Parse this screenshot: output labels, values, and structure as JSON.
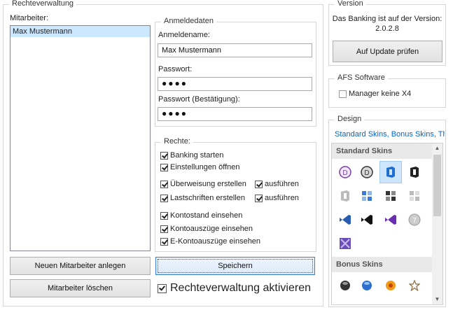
{
  "rechte_group": {
    "title": "Rechteverwaltung",
    "mitarbeiter_label": "Mitarbeiter:",
    "mitarbeiter": [
      "Max Mustermann"
    ],
    "new_button": "Neuen Mitarbeiter anlegen",
    "delete_button": "Mitarbeiter löschen",
    "save_button": "Speichern",
    "activate_label": "Rechteverwaltung aktivieren"
  },
  "anmeldedaten": {
    "title": "Anmeldedaten",
    "name_label": "Anmeldename:",
    "name_value": "Max Mustermann",
    "password_label": "Passwort:",
    "password_value": "●●●●",
    "password_confirm_label": "Passwort (Bestätigung):",
    "password_confirm_value": "●●●●"
  },
  "rechte": {
    "title": "Rechte:",
    "items": [
      "Banking starten",
      "Einstellungen öffnen",
      "Überweisung erstellen",
      "Lastschriften erstellen",
      "Kontostand einsehen",
      "Kontoauszüge einsehen",
      "E-Kontoauszüge einsehen"
    ],
    "ausfuehren": "ausführen"
  },
  "version": {
    "title": "Version",
    "text_line1": "Das Banking ist auf der Version:",
    "text_line2": "2.0.2.8",
    "update_button": "Auf Update prüfen"
  },
  "afs": {
    "title": "AFS Software",
    "manager_label": "Manager keine X4"
  },
  "design": {
    "title": "Design",
    "links": "Standard Skins, Bonus Skins, The",
    "standard_header": "Standard Skins",
    "bonus_header": "Bonus Skins",
    "standard_icons": [
      "vs-purple-icon",
      "vs-dark-icon",
      "office-blue-icon",
      "office-black-icon",
      "office-white-icon",
      "metro-blue-icon",
      "metro-dark-icon",
      "metro-light-icon",
      "vs-blue-icon",
      "vs-black-icon",
      "vs-violet-icon",
      "seven-classic-icon",
      "vs-light-purple-icon"
    ],
    "bonus_icons": [
      "black-ball-icon",
      "blue-ball-icon",
      "orange-ring-icon",
      "star-icon"
    ]
  },
  "colors": {
    "accent": "#0066cc",
    "selected": "#cce8ff"
  }
}
